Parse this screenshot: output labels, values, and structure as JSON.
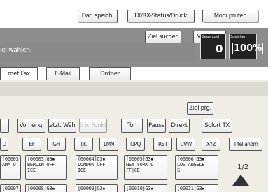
{
  "top_bar": {
    "dat_speich": "Dat. speich.",
    "tx_rx_status": "TX/RX-Status/Druck.",
    "modi_pruefen": "Modi prüfen"
  },
  "header": {
    "prompt": "iel wählen.",
    "ziel_suchen": "Ziel suchen",
    "vorschau": "Vorschau",
    "counter_label": "Gesamtziel",
    "counter_value": "0",
    "memory_label": "Speicher",
    "memory_value": "100%"
  },
  "tabs": {
    "internet_fax": "rnet Fax",
    "email": "E-Mail",
    "ordner": "Ordner"
  },
  "ziel_prg": "Ziel prg.",
  "toolbar": {
    "first": "",
    "vorherig": "Vorherig.",
    "letzte_wahl": "Letzt. Wähl.",
    "erw_funkt": "Erw. Funkt.",
    "ton": "Ton",
    "pause": "Pause",
    "direkt": "Direkt",
    "sofort_tx": "Sofort TX"
  },
  "index_keys": [
    "D",
    "EF",
    "GH",
    "IJK",
    "LMN",
    "OPQ",
    "RST",
    "UVW",
    "XYZ"
  ],
  "titel_aendern": "Titel ändrn",
  "destinations": [
    {
      "line1": "[00003]G3▪",
      "line2": "AMA O",
      "line3": ""
    },
    {
      "line1": "[00003]G3▪",
      "line2": "BERLIN OFF",
      "line3": "ICE"
    },
    {
      "line1": "[00004]G3▪",
      "line2": "LONDON OFF",
      "line3": "ICE"
    },
    {
      "line1": "[00005]G3▪",
      "line2": "NEW YORK O",
      "line3": "FF|CE"
    },
    {
      "line1": "[00006]G3▪",
      "line2": "LOS ANGELE",
      "line3": "S"
    }
  ],
  "page_indicator": "1/2",
  "next_row": [
    "[00007]G3▪",
    "[00008]G3▪",
    "[00009]G3▪",
    "[00010]G3▪",
    "[00011]G3▪"
  ]
}
